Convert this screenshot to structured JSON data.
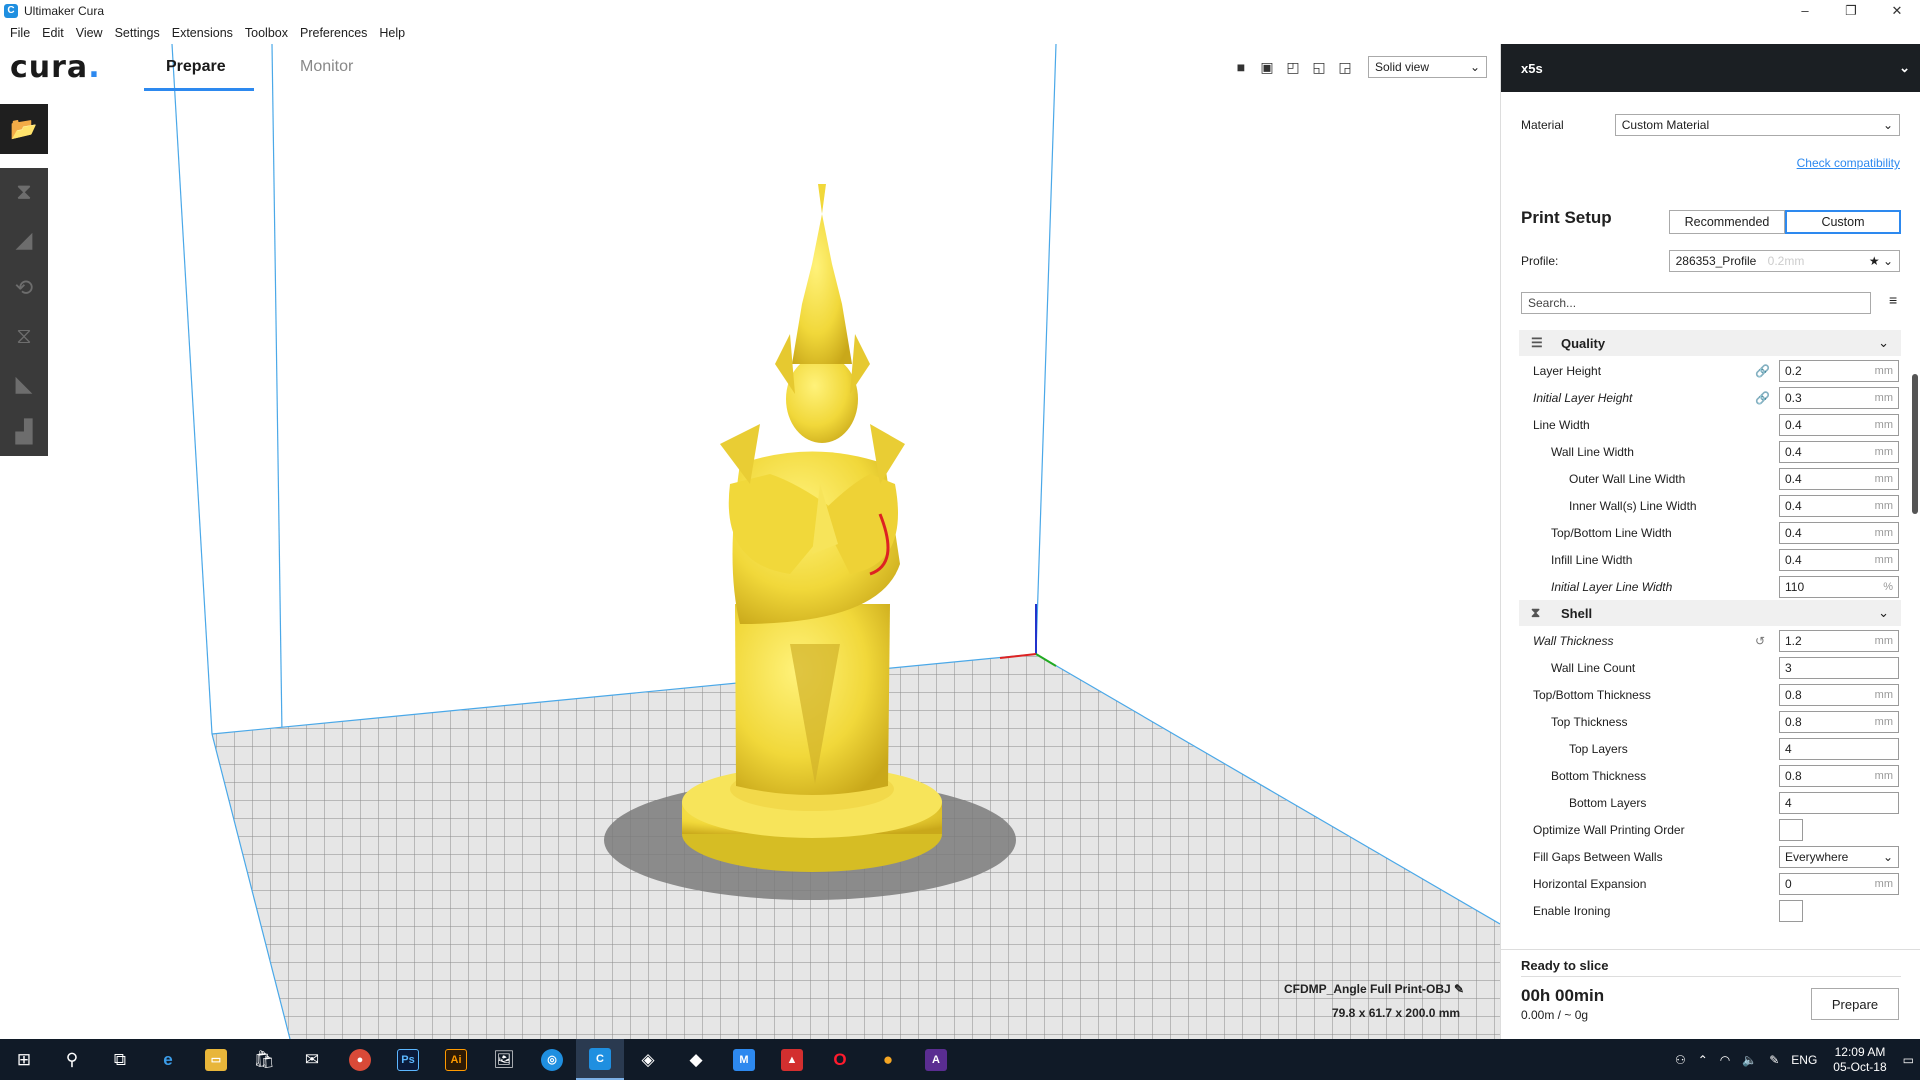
{
  "window": {
    "title": "Ultimaker Cura",
    "minimize": "–",
    "maximize": "❐",
    "close": "✕"
  },
  "menu": [
    "File",
    "Edit",
    "View",
    "Settings",
    "Extensions",
    "Toolbox",
    "Preferences",
    "Help"
  ],
  "header": {
    "logo": "cura",
    "logo_dot": ".",
    "tabs": {
      "prepare": "Prepare",
      "monitor": "Monitor"
    },
    "view_mode": "Solid view"
  },
  "model": {
    "name": "CFDMP_Angle Full Print-OBJ",
    "dimensions": "79.8 x 61.7 x 200.0 mm"
  },
  "sidebar": {
    "machine": "x5s",
    "material_label": "Material",
    "material_value": "Custom Material",
    "check_compatibility": "Check compatibility",
    "print_setup_title": "Print Setup",
    "mode_recommended": "Recommended",
    "mode_custom": "Custom",
    "profile_label": "Profile:",
    "profile_value": "286353_Profile",
    "profile_hint": "0.2mm",
    "search_placeholder": "Search...",
    "categories": {
      "quality": "Quality",
      "shell": "Shell"
    },
    "settings": {
      "layer_height": {
        "label": "Layer Height",
        "value": "0.2",
        "unit": "mm"
      },
      "initial_layer_height": {
        "label": "Initial Layer Height",
        "value": "0.3",
        "unit": "mm"
      },
      "line_width": {
        "label": "Line Width",
        "value": "0.4",
        "unit": "mm"
      },
      "wall_line_width": {
        "label": "Wall Line Width",
        "value": "0.4",
        "unit": "mm"
      },
      "outer_wall_line_width": {
        "label": "Outer Wall Line Width",
        "value": "0.4",
        "unit": "mm"
      },
      "inner_wall_line_width": {
        "label": "Inner Wall(s) Line Width",
        "value": "0.4",
        "unit": "mm"
      },
      "top_bottom_line_width": {
        "label": "Top/Bottom Line Width",
        "value": "0.4",
        "unit": "mm"
      },
      "infill_line_width": {
        "label": "Infill Line Width",
        "value": "0.4",
        "unit": "mm"
      },
      "initial_layer_line_width": {
        "label": "Initial Layer Line Width",
        "value": "110",
        "unit": "%"
      },
      "wall_thickness": {
        "label": "Wall Thickness",
        "value": "1.2",
        "unit": "mm"
      },
      "wall_line_count": {
        "label": "Wall Line Count",
        "value": "3"
      },
      "top_bottom_thickness": {
        "label": "Top/Bottom Thickness",
        "value": "0.8",
        "unit": "mm"
      },
      "top_thickness": {
        "label": "Top Thickness",
        "value": "0.8",
        "unit": "mm"
      },
      "top_layers": {
        "label": "Top Layers",
        "value": "4"
      },
      "bottom_thickness": {
        "label": "Bottom Thickness",
        "value": "0.8",
        "unit": "mm"
      },
      "bottom_layers": {
        "label": "Bottom Layers",
        "value": "4"
      },
      "optimize_wall_order": {
        "label": "Optimize Wall Printing Order",
        "checked": false
      },
      "fill_gaps": {
        "label": "Fill Gaps Between Walls",
        "value": "Everywhere"
      },
      "horizontal_expansion": {
        "label": "Horizontal Expansion",
        "value": "0",
        "unit": "mm"
      },
      "enable_ironing": {
        "label": "Enable Ironing",
        "checked": false
      }
    },
    "slice": {
      "status": "Ready to slice",
      "time": "00h 00min",
      "usage": "0.00m / ~ 0g",
      "button": "Prepare"
    }
  },
  "taskbar": {
    "lang": "ENG",
    "time": "12:09 AM",
    "date": "05-Oct-18",
    "apps": [
      "ps",
      "ai"
    ],
    "app_labels": {
      "ps": "Ps",
      "ai": "Ai"
    }
  },
  "colors": {
    "accent": "#2d89ef",
    "model": "#f5e34a",
    "machine_bar": "#1b1f23",
    "taskbar": "#101a27"
  }
}
